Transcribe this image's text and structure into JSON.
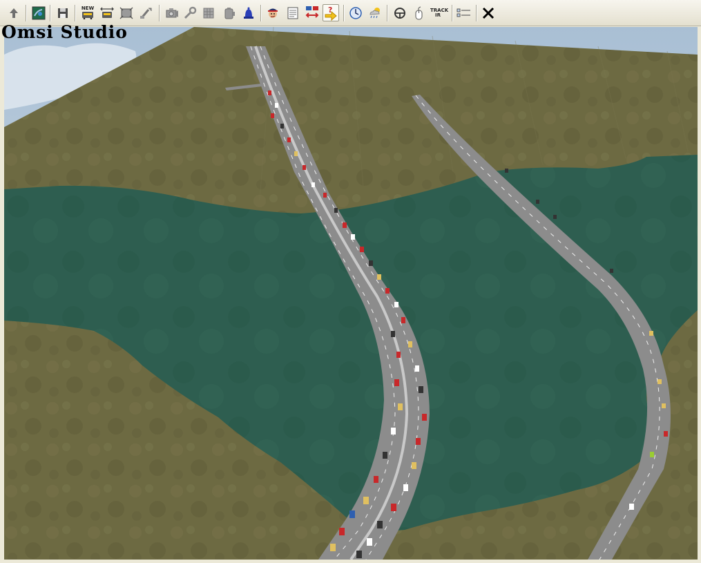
{
  "app": {
    "title": "Omsi Studio"
  },
  "toolbar": {
    "buttons": [
      {
        "name": "up-arrow-icon"
      },
      {
        "name": "map-icon"
      },
      {
        "name": "save-icon"
      },
      {
        "name": "new-bus-icon",
        "label": "NEW"
      },
      {
        "name": "bus-move-icon"
      },
      {
        "name": "bus-frame-icon"
      },
      {
        "name": "pointer-icon"
      },
      {
        "name": "camera-icon"
      },
      {
        "name": "wrench-icon"
      },
      {
        "name": "grid-icon"
      },
      {
        "name": "tank-icon"
      },
      {
        "name": "bell-icon"
      },
      {
        "name": "driver-icon"
      },
      {
        "name": "timetable-icon"
      },
      {
        "name": "swap-icon"
      },
      {
        "name": "help-icon",
        "label": "?"
      },
      {
        "name": "clock-icon"
      },
      {
        "name": "weather-icon"
      },
      {
        "name": "steering-wheel-icon"
      },
      {
        "name": "mouse-icon"
      },
      {
        "name": "trackir-icon",
        "label": "TRACK IR"
      },
      {
        "name": "settings-list-icon"
      },
      {
        "name": "close-icon"
      }
    ],
    "colors": {
      "accent_blue": "#2e5fb0",
      "accent_red": "#c8282a",
      "accent_yellow": "#f2c21b"
    }
  },
  "scene": {
    "colors": {
      "sky": "#b7c9d9",
      "grass": "#6e6a43",
      "water": "#2d5d4f",
      "road": "#8a8a8a"
    }
  }
}
